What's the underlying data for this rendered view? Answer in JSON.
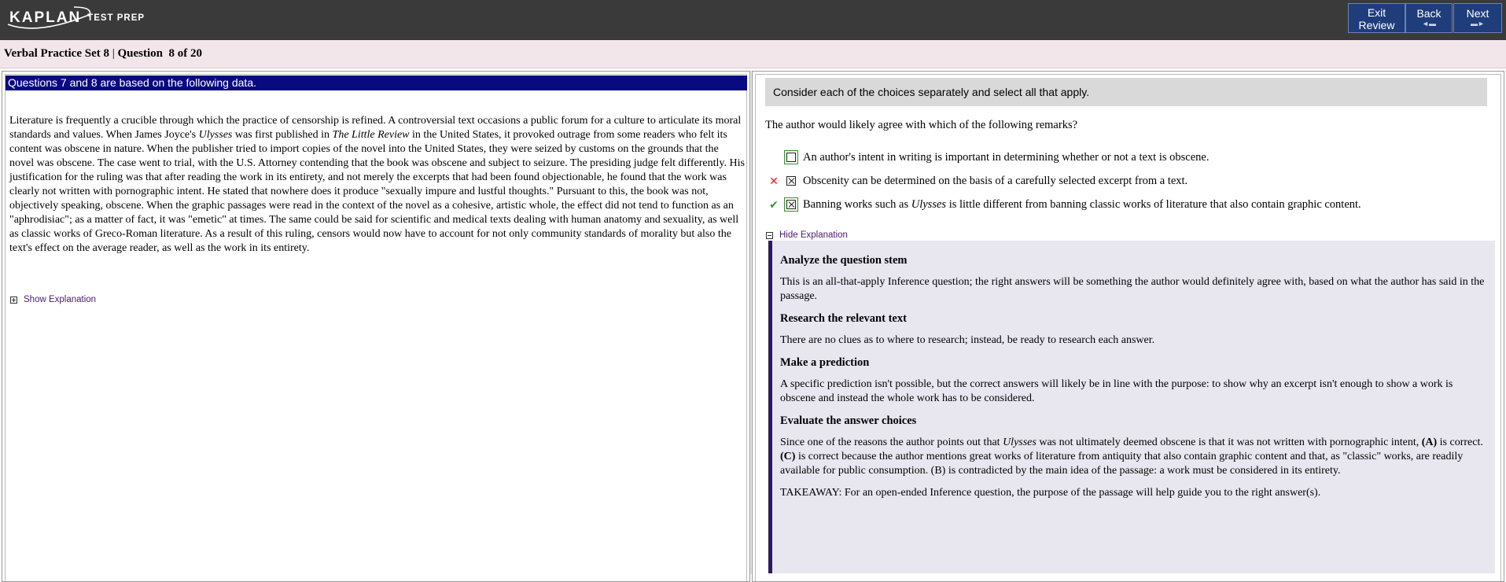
{
  "header": {
    "logo_brand": "KAPLAN",
    "logo_sub": "TEST PREP",
    "exit_review_line1": "Exit",
    "exit_review_line2": "Review",
    "back_label": "Back",
    "next_label": "Next"
  },
  "title": {
    "set_name": "Verbal Practice Set 8",
    "separator": " | ",
    "question_label": "Question",
    "question_position": "8 of 20"
  },
  "passage": {
    "header": "Questions 7 and 8 are based on the following data.",
    "text_parts": {
      "p1": "Literature is frequently a crucible through which the practice of censorship is refined. A controversial text occasions a public forum for a culture to articulate its moral standards and values. When James Joyce's ",
      "i1": "Ulysses",
      "p2": " was first published in ",
      "i2": "The Little Review",
      "p3": " in the United States, it provoked outrage from some readers who felt its content was obscene in nature. When the publisher tried to import copies of the novel into the United States, they were seized by customs on the grounds that the novel was obscene. The case went to trial, with the U.S. Attorney contending that the book was obscene and subject to seizure. The presiding judge felt differently. His justification for the ruling was that after reading the work in its entirety, and not merely the excerpts that had been found objectionable, he found that the work was clearly not written with pornographic intent. He stated that nowhere does it produce \"sexually impure and lustful thoughts.\" Pursuant to this, the book was not, objectively speaking, obscene. When the graphic passages were read in the context of the novel as a cohesive, artistic whole, the effect did not tend to function as an \"aphrodisiac\"; as a matter of fact, it was \"emetic\" at times. The same could be said for scientific and medical texts dealing with human anatomy and sexuality, as well as classic works of Greco-Roman literature. As a result of this ruling, censors would now have to account for not only community standards of morality but also the text's effect on the average reader, as well as the work in its entirety."
    },
    "show_explanation": "Show Explanation"
  },
  "question": {
    "instruction": "Consider each of the choices separately and select all that apply.",
    "stem": "The author would likely agree with which of the following remarks?",
    "choices": [
      {
        "text": "An author's intent in writing is important in determining whether or not a text is obscene.",
        "checked": false,
        "result": ""
      },
      {
        "text": "Obscenity can be determined on the basis of a carefully selected excerpt from a text.",
        "checked": true,
        "result": "incorrect"
      },
      {
        "pre": "Banning works such as ",
        "italic": "Ulysses",
        "post": " is little different from banning classic works of literature that also contain graphic content.",
        "checked": true,
        "result": "correct"
      }
    ],
    "incorrect_mark": "✕",
    "correct_mark": "✔",
    "hide_explanation": "Hide Explanation"
  },
  "explanation": {
    "h1": "Analyze the question stem",
    "p1": "This is an all-that-apply Inference question; the right answers will be something the author would definitely agree with, based on what the author has said in the passage.",
    "h2": "Research the relevant text",
    "p2": "There are no clues as to where to research; instead, be ready to research each answer.",
    "h3": "Make a prediction",
    "p3": "A specific prediction isn't possible, but the correct answers will likely be in line with the purpose: to show why an excerpt isn't enough to show a work is obscene and instead the whole work has to be considered.",
    "h4": "Evaluate the answer choices",
    "p4_parts": {
      "a": "Since one of the reasons the author points out that ",
      "b": "Ulysses",
      "c": " was not ultimately deemed obscene is that it was not written with pornographic intent, ",
      "d": "(A)",
      "e": " is correct. ",
      "f": "(C)",
      "g": " is correct because the author mentions great works of literature from antiquity that also contain graphic content and that, as \"classic\" works, are readily available for public consumption. (B) is contradicted by the main idea of the passage: a work must be considered in its entirety."
    },
    "takeaway": "TAKEAWAY: For an open-ended Inference question, the purpose of the passage will help guide you to the right answer(s)."
  },
  "colors": {
    "topbar": "#3a3a3a",
    "button": "#1f3d7a",
    "passage_header": "#0a0a80",
    "explanation_bg": "#e8e6ef",
    "explanation_border": "#2e1a5e",
    "incorrect": "#e02020",
    "correct": "#2e9a2e"
  }
}
